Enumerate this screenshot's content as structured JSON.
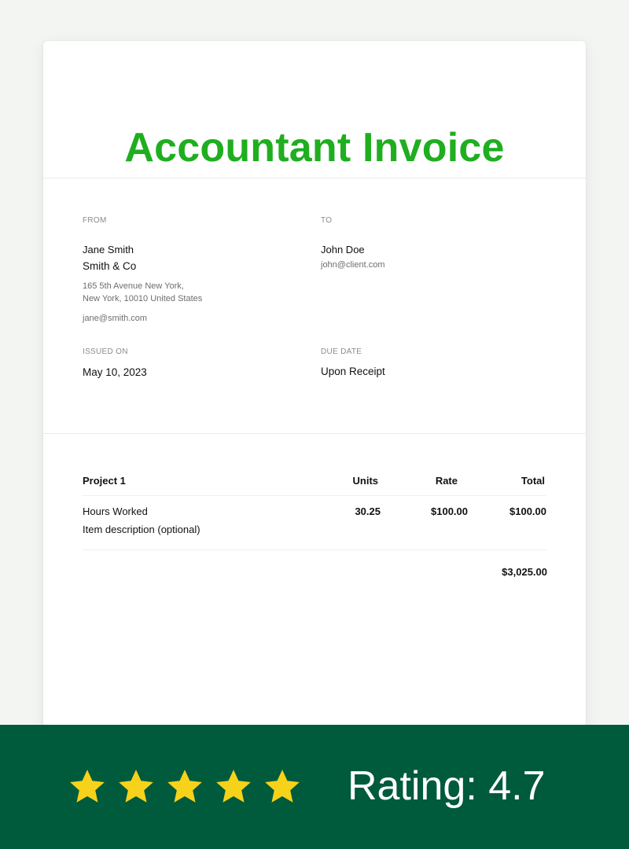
{
  "invoice": {
    "title": "Accountant Invoice",
    "from": {
      "label": "FROM",
      "name": "Jane Smith",
      "company": "Smith & Co",
      "address_line1": "165 5th Avenue New York,",
      "address_line2": "New York, 10010 United States",
      "email": "jane@smith.com"
    },
    "to": {
      "label": "TO",
      "name": "John Doe",
      "email": "john@client.com"
    },
    "issued": {
      "label": "ISSUED ON",
      "value": "May 10, 2023"
    },
    "due": {
      "label": "DUE DATE",
      "value": "Upon Receipt"
    },
    "table": {
      "headers": {
        "project": "Project 1",
        "units": "Units",
        "rate": "Rate",
        "total": "Total"
      },
      "items": [
        {
          "name": "Hours Worked",
          "description": "Item description (optional)",
          "units": "30.25",
          "rate": "$100.00",
          "total": "$100.00"
        }
      ],
      "grand_total": "$3,025.00"
    }
  },
  "banner": {
    "stars": 5,
    "rating_text": "Rating: 4.7",
    "star_color": "#f7d21a",
    "background": "#005a3c"
  }
}
